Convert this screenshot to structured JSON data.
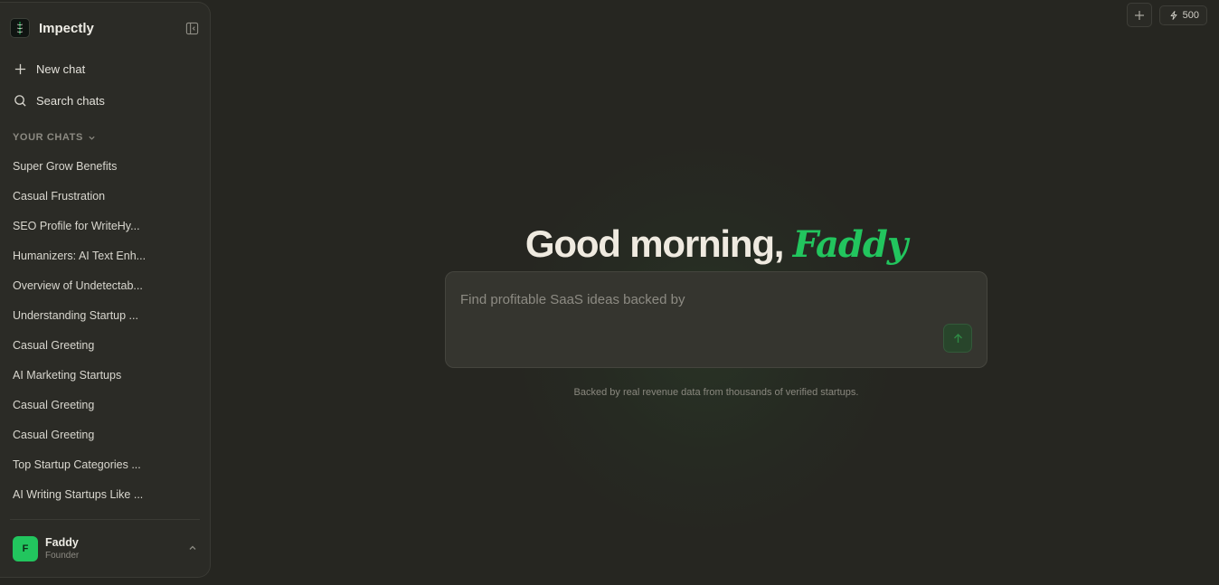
{
  "app": {
    "name": "Impectly"
  },
  "sidebar": {
    "actions": [
      {
        "label": "New chat",
        "icon": "plus-icon"
      },
      {
        "label": "Search chats",
        "icon": "search-icon"
      }
    ],
    "section_title": "YOUR CHATS",
    "chats": [
      "Super Grow Benefits",
      "Casual Frustration",
      "SEO Profile for WriteHy...",
      "Humanizers: AI Text Enh...",
      "Overview of Undetectab...",
      "Understanding Startup ...",
      "Casual Greeting",
      "AI Marketing Startups",
      "Casual Greeting",
      "Casual Greeting",
      "Top Startup Categories ...",
      "AI Writing Startups Like ..."
    ],
    "user": {
      "initial": "F",
      "name": "Faddy",
      "role": "Founder"
    }
  },
  "topbar": {
    "credits": "500"
  },
  "main": {
    "greeting": "Good morning,",
    "greeting_name": "Faddy",
    "prompt_placeholder": "Find profitable SaaS ideas backed by",
    "disclaimer": "Backed by real revenue data from thousands of verified startups."
  },
  "colors": {
    "background": "#262621",
    "sidebar": "#2b2b26",
    "accent": "#22c55e",
    "input": "#35352f"
  }
}
